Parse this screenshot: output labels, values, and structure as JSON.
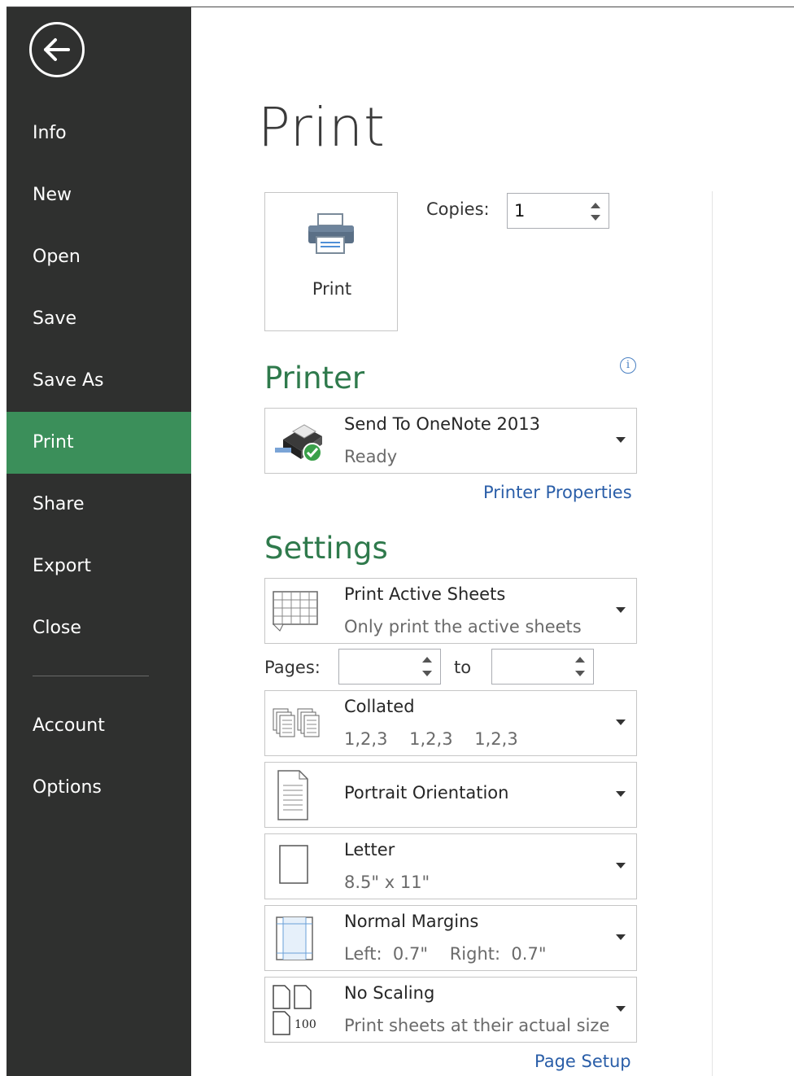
{
  "sidebar": {
    "items": [
      {
        "label": "Info"
      },
      {
        "label": "New"
      },
      {
        "label": "Open"
      },
      {
        "label": "Save"
      },
      {
        "label": "Save As"
      },
      {
        "label": "Print"
      },
      {
        "label": "Share"
      },
      {
        "label": "Export"
      },
      {
        "label": "Close"
      },
      {
        "label": "Account"
      },
      {
        "label": "Options"
      }
    ],
    "active": "Print"
  },
  "page": {
    "title": "Print"
  },
  "print_button": {
    "label": "Print"
  },
  "copies": {
    "label": "Copies:",
    "value": "1"
  },
  "printer": {
    "heading": "Printer",
    "name": "Send To OneNote 2013",
    "status": "Ready",
    "properties_link": "Printer Properties"
  },
  "settings": {
    "heading": "Settings",
    "what": {
      "title": "Print Active Sheets",
      "subtitle": "Only print the active sheets"
    },
    "pages": {
      "label": "Pages:",
      "to_label": "to",
      "from_value": "",
      "to_value": ""
    },
    "collation": {
      "title": "Collated",
      "subtitle": "1,2,3    1,2,3    1,2,3"
    },
    "orientation": {
      "title": "Portrait Orientation"
    },
    "paper": {
      "title": "Letter",
      "subtitle": "8.5\" x 11\""
    },
    "margins": {
      "title": "Normal Margins",
      "subtitle": "Left:  0.7\"    Right:  0.7\""
    },
    "scaling": {
      "title": "No Scaling",
      "subtitle": "Print sheets at their actual size",
      "icon_label": "100"
    },
    "page_setup_link": "Page Setup"
  },
  "colors": {
    "sidebar_bg": "#2f302f",
    "active_bg": "#3b8f5a",
    "heading_green": "#2f7a4c",
    "link_blue": "#2a5ea8"
  }
}
